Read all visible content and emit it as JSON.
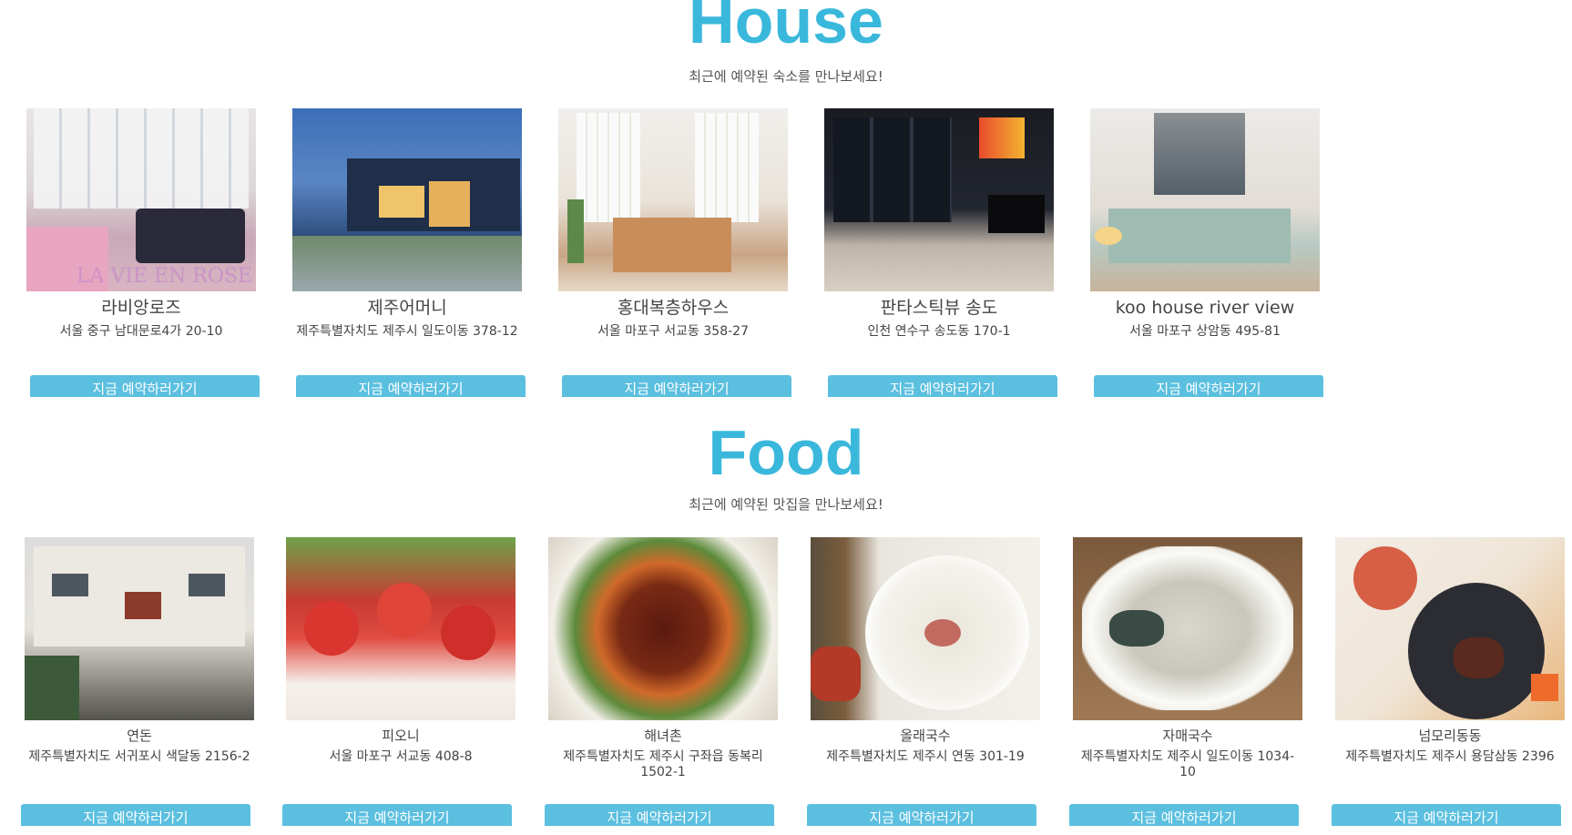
{
  "house": {
    "title": "House",
    "subtitle": "최근에 예약된 숙소를 만나보세요!",
    "cards": [
      {
        "name": "라비앙로즈",
        "address": "서울 중구 남대문로4가 20-10",
        "button": "지금 예약하러가기",
        "photo_icon": "bedroom-photo",
        "overlay_text": "LA VIE EN ROSE"
      },
      {
        "name": "제주어머니",
        "address": "제주특별자치도 제주시 일도이동 378-12",
        "button": "지금 예약하러가기",
        "photo_icon": "house-exterior-photo"
      },
      {
        "name": "홍대복층하우스",
        "address": "서울 마포구 서교동 358-27",
        "button": "지금 예약하러가기",
        "photo_icon": "bedroom-photo"
      },
      {
        "name": "판타스틱뷰 송도",
        "address": "인천 연수구 송도동 170-1",
        "button": "지금 예약하러가기",
        "photo_icon": "night-view-bedroom-photo"
      },
      {
        "name": "koo house river view",
        "address": "서울 마포구 상암동 495-81",
        "button": "지금 예약하러가기",
        "photo_icon": "river-view-bedroom-photo"
      }
    ]
  },
  "food": {
    "title": "Food",
    "subtitle": "최근에 예약된 맛집을 만나보세요!",
    "cards": [
      {
        "name": "연돈",
        "address": "제주특별자치도 서귀포시 색달동 2156-2",
        "button": "지금 예약하러가기",
        "photo_icon": "restaurant-building-photo"
      },
      {
        "name": "피오니",
        "address": "서울 마포구 서교동 408-8",
        "button": "지금 예약하러가기",
        "photo_icon": "strawberry-cake-photo"
      },
      {
        "name": "해녀촌",
        "address": "제주특별자치도 제주시 구좌읍 동복리 1502-1",
        "button": "지금 예약하러가기",
        "photo_icon": "spicy-noodles-photo"
      },
      {
        "name": "올래국수",
        "address": "제주특별자치도 제주시 연동 301-19",
        "button": "지금 예약하러가기",
        "photo_icon": "noodle-soup-photo"
      },
      {
        "name": "자매국수",
        "address": "제주특별자치도 제주시 일도이동 1034-10",
        "button": "지금 예약하러가기",
        "photo_icon": "pork-noodle-soup-photo"
      },
      {
        "name": "넘모리동동",
        "address": "제주특별자치도 제주시 용담삼동 2396",
        "button": "지금 예약하러가기",
        "photo_icon": "steak-plate-photo"
      }
    ]
  },
  "colors": {
    "accent": "#3ab8dc",
    "button": "#5bbfdf"
  }
}
